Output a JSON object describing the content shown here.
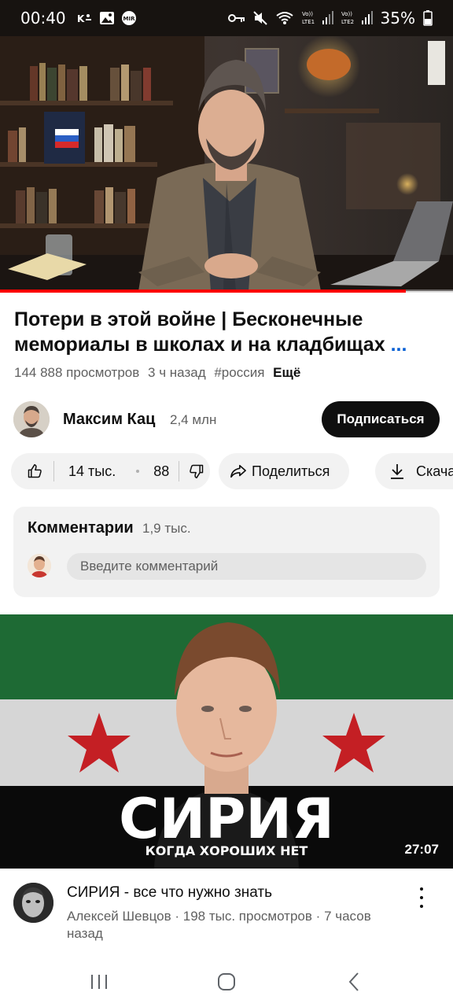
{
  "status_bar": {
    "time": "00:40",
    "battery": "35%",
    "icons_left": [
      "network-speed-icon",
      "gallery-icon",
      "mir-pay-icon"
    ],
    "icons_right": [
      "key-icon",
      "mute-icon",
      "wifi-icon",
      "sim1-signal-icon",
      "sim2-signal-icon",
      "battery-icon"
    ],
    "sim1_label_top": "Vo))",
    "sim1_label_bottom": "LTE1",
    "sim2_label_top": "Vo))",
    "sim2_label_bottom": "LTE2",
    "mir_label": "MIR"
  },
  "player": {
    "progress": 0.895,
    "colors": {
      "progress": "#ff0000"
    }
  },
  "video": {
    "title": "Потери в этой войне | Бесконечные мемориалы в школах и на кладбищах",
    "title_more": "...",
    "views": "144 888 просмотров",
    "age": "3 ч назад",
    "hashtag": "#россия",
    "more_label": "Ещё"
  },
  "channel": {
    "name": "Максим Кац",
    "subscribers": "2,4 млн",
    "subscribe_label": "Подписаться"
  },
  "actions": {
    "likes": "14 тыс.",
    "dislikes": "88",
    "share_label": "Поделиться",
    "download_label": "Скача"
  },
  "comments": {
    "title": "Комментарии",
    "count": "1,9 тыс.",
    "placeholder": "Введите комментарий"
  },
  "recommended": {
    "thumbnail_title": "СИРИЯ",
    "thumbnail_subtitle": "КОГДА ХОРОШИХ НЕТ",
    "duration": "27:07",
    "title": "СИРИЯ - все что нужно знать",
    "channel": "Алексей Шевцов",
    "views": "198 тыс. просмотров",
    "age": "7 часов",
    "age_line2": "назад",
    "separator": "·"
  },
  "nav": {
    "icons": [
      "recent-apps-icon",
      "home-icon",
      "back-icon"
    ]
  }
}
